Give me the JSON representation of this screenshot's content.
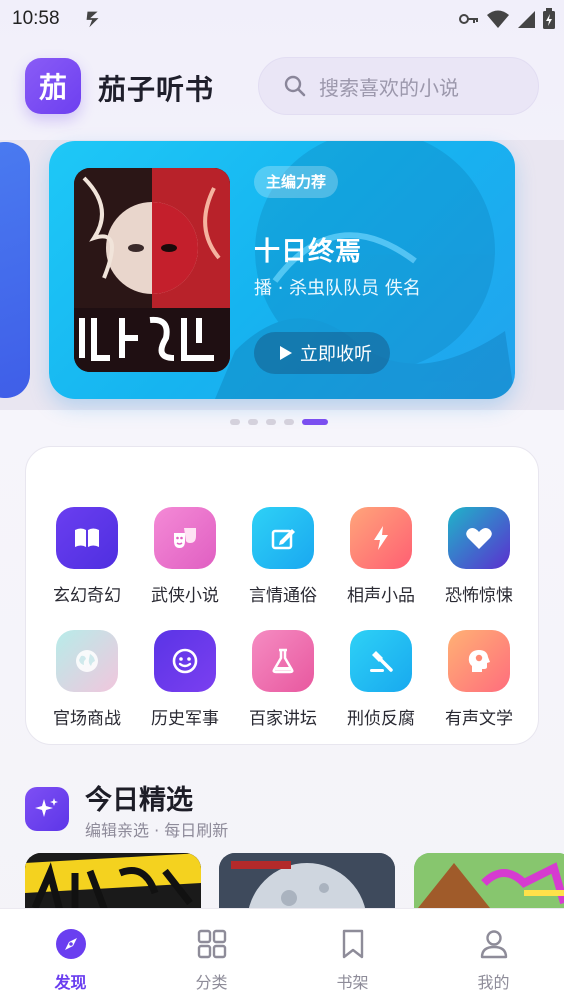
{
  "status_bar": {
    "time": "10:58"
  },
  "app": {
    "logo_text": "茄",
    "name": "茄子听书"
  },
  "search": {
    "placeholder": "搜索喜欢的小说"
  },
  "carousel": {
    "badge": "主编力荐",
    "title": "十日终焉",
    "meta": "播 · 杀虫队队员  佚名",
    "listen_label": "立即收听",
    "slide_count": 5,
    "active_index": 4
  },
  "categories": [
    {
      "label": "玄幻奇幻",
      "icon": "book-open-icon",
      "color1": "#6a3ef0",
      "color2": "#4f2fe0"
    },
    {
      "label": "武侠小说",
      "icon": "masks-icon",
      "color1": "#f48ad6",
      "color2": "#e05fc2"
    },
    {
      "label": "言情通俗",
      "icon": "edit-icon",
      "color1": "#2ed1f6",
      "color2": "#1aa8f0"
    },
    {
      "label": "相声小品",
      "icon": "lightning-icon",
      "color1": "#ff9a7a",
      "color2": "#ff5f73"
    },
    {
      "label": "恐怖惊悚",
      "icon": "heart-icon",
      "color1": "#1fb5c9",
      "color2": "#5b2fcf"
    },
    {
      "label": "官场商战",
      "icon": "globe-icon",
      "color1": "#b7ece9",
      "color2": "#f1c6dd"
    },
    {
      "label": "历史军事",
      "icon": "face-icon",
      "color1": "#5a34e6",
      "color2": "#7b3ff0"
    },
    {
      "label": "百家讲坛",
      "icon": "flask-icon",
      "color1": "#f58cc2",
      "color2": "#e8589f"
    },
    {
      "label": "刑侦反腐",
      "icon": "gavel-icon",
      "color1": "#2ed1f6",
      "color2": "#18a9ef"
    },
    {
      "label": "有声文学",
      "icon": "head-idea-icon",
      "color1": "#ffb174",
      "color2": "#ff6d7d"
    }
  ],
  "today": {
    "title": "今日精选",
    "subtitle": "编辑亲选 · 每日刷新"
  },
  "nav": [
    {
      "label": "发现",
      "icon": "compass-icon",
      "active": true
    },
    {
      "label": "分类",
      "icon": "grid-icon",
      "active": false
    },
    {
      "label": "书架",
      "icon": "bookmark-icon",
      "active": false
    },
    {
      "label": "我的",
      "icon": "user-icon",
      "active": false
    }
  ],
  "colors": {
    "accent": "#6a3ef0",
    "banner": "#1ec8f7"
  }
}
